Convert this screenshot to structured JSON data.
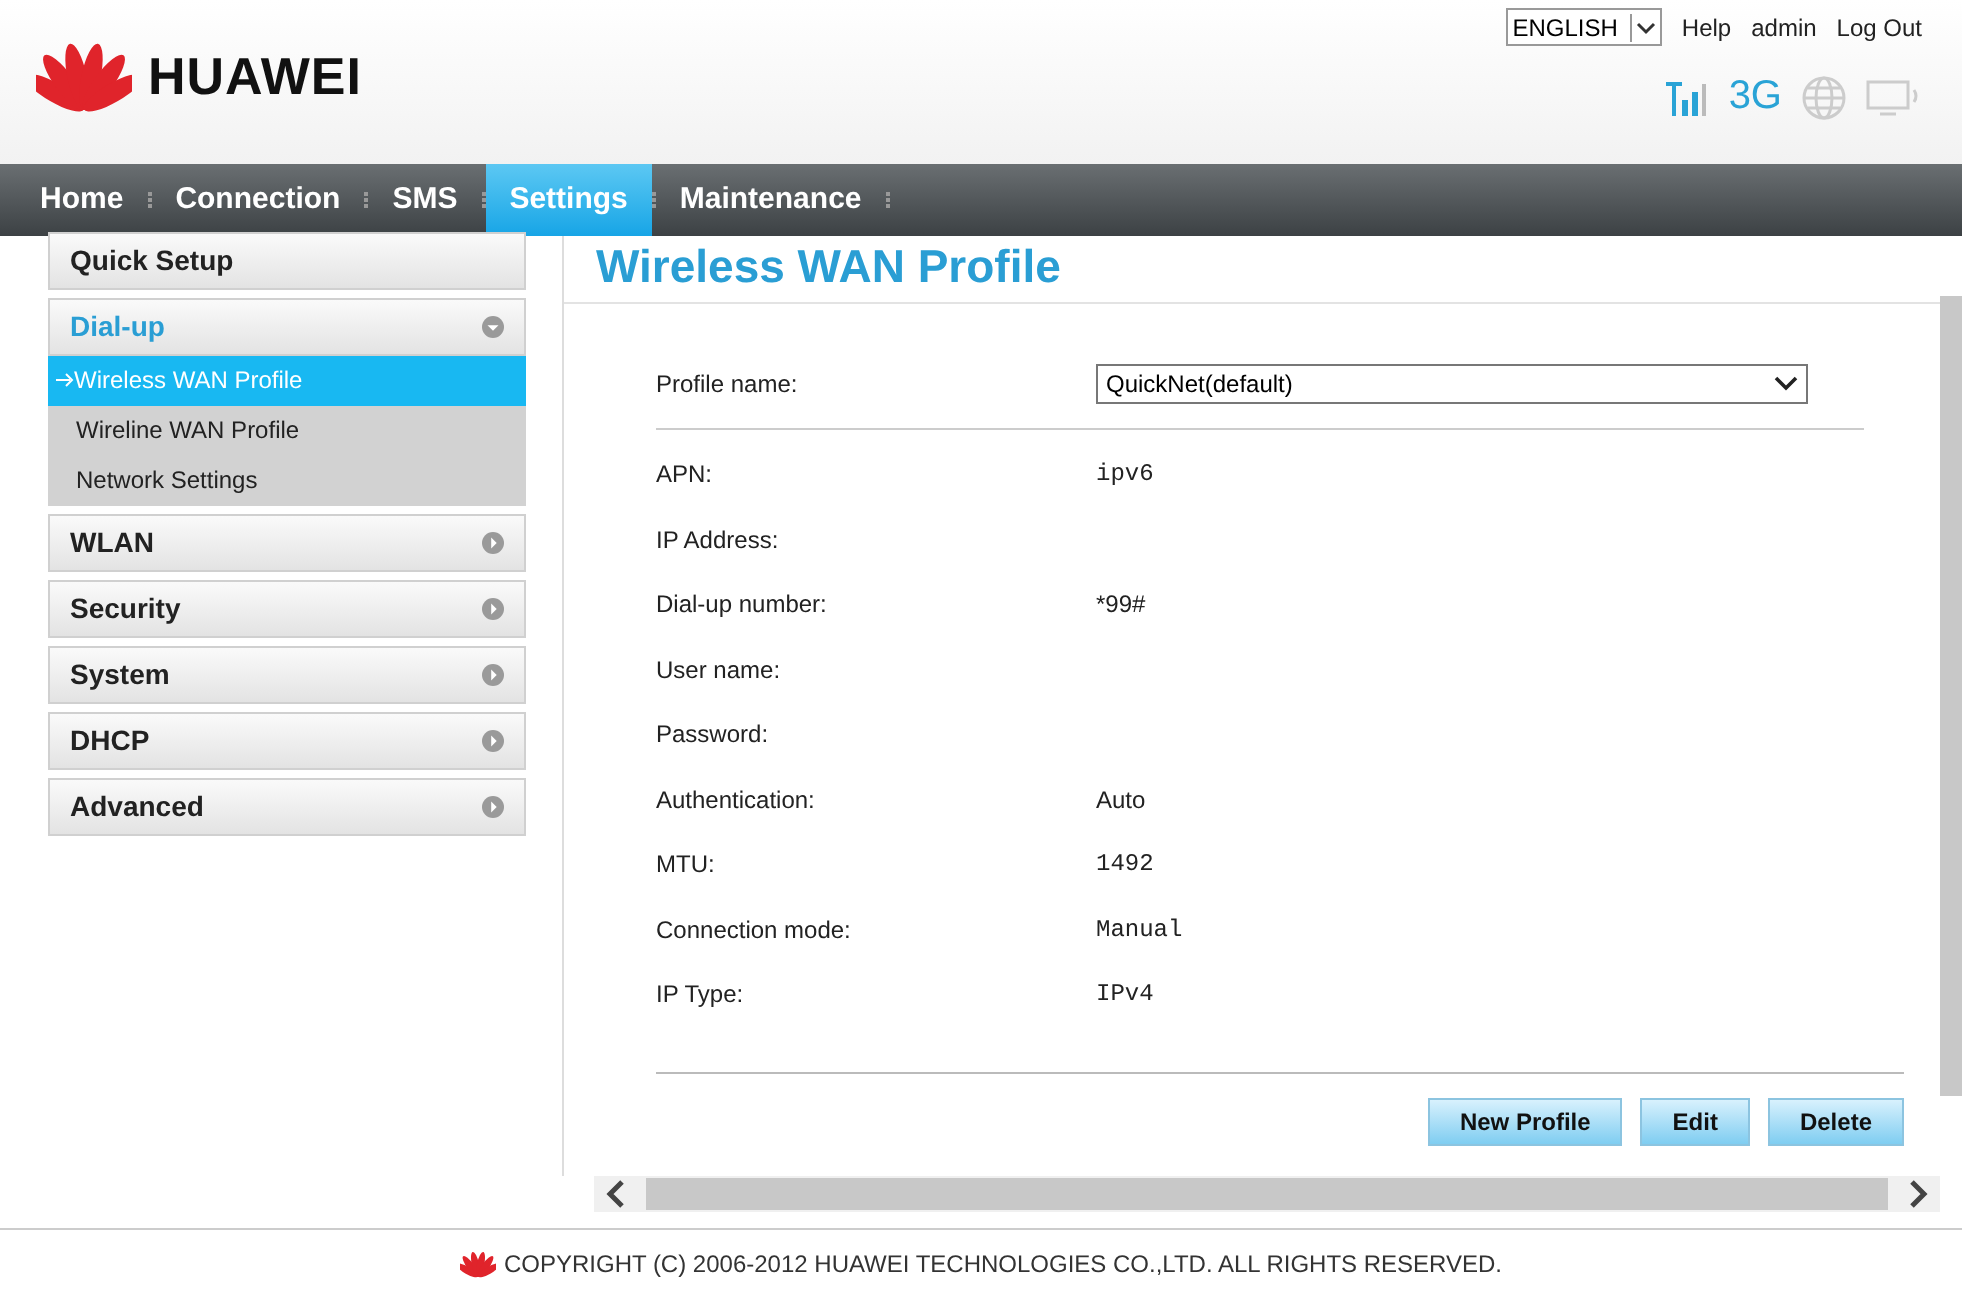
{
  "header": {
    "brand": "HUAWEI",
    "language": "ENGLISH",
    "links": [
      "Help",
      "admin",
      "Log Out"
    ],
    "network": "3G"
  },
  "nav": [
    {
      "label": "Home",
      "selected": false
    },
    {
      "label": "Connection",
      "selected": false
    },
    {
      "label": "SMS",
      "selected": false
    },
    {
      "label": "Settings",
      "selected": true
    },
    {
      "label": "Maintenance",
      "selected": false
    }
  ],
  "sidebar": [
    {
      "label": "Quick Setup",
      "kind": "plain"
    },
    {
      "label": "Dial-up",
      "kind": "group",
      "expanded": true,
      "children": [
        {
          "label": "Wireless WAN Profile",
          "selected": true
        },
        {
          "label": "Wireline WAN Profile",
          "selected": false
        },
        {
          "label": "Network Settings",
          "selected": false
        }
      ]
    },
    {
      "label": "WLAN",
      "kind": "group",
      "expanded": false
    },
    {
      "label": "Security",
      "kind": "group",
      "expanded": false
    },
    {
      "label": "System",
      "kind": "group",
      "expanded": false
    },
    {
      "label": "DHCP",
      "kind": "group",
      "expanded": false
    },
    {
      "label": "Advanced",
      "kind": "group",
      "expanded": false
    }
  ],
  "page": {
    "title": "Wireless WAN Profile",
    "profile_label": "Profile name:",
    "profile_value": "QuickNet(default)",
    "fields": [
      {
        "label": "APN:",
        "value": "ipv6",
        "mono": true
      },
      {
        "label": "IP Address:"
      },
      {
        "label": "Dial-up number:",
        "value": "*99#",
        "mono": false
      },
      {
        "label": "User name:"
      },
      {
        "label": "Password:"
      },
      {
        "label": "Authentication:",
        "value": "Auto",
        "mono": false
      },
      {
        "label": "MTU:",
        "value": "1492",
        "mono": true
      },
      {
        "label": "Connection mode:",
        "value": "Manual",
        "mono": true
      },
      {
        "label": "IP Type:",
        "value": "IPv4",
        "mono": true
      }
    ],
    "buttons": [
      "New Profile",
      "Edit",
      "Delete"
    ]
  },
  "footer": "COPYRIGHT (C) 2006-2012 HUAWEI TECHNOLOGIES CO.,LTD. ALL RIGHTS RESERVED."
}
